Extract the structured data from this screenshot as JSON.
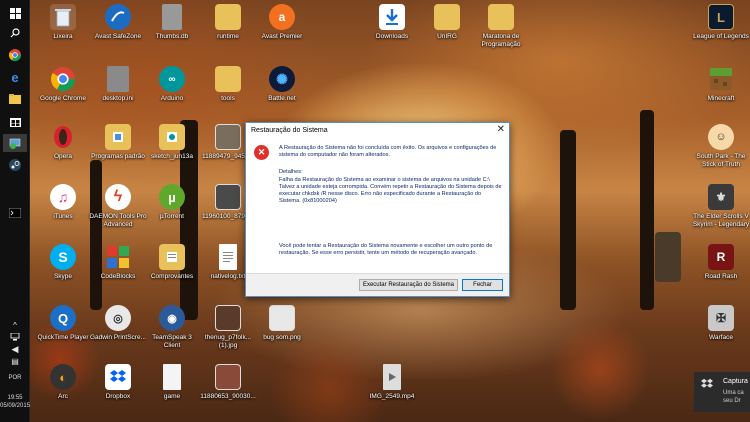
{
  "desktop_icons": [
    {
      "name": "lixeira",
      "label": "Lixeira",
      "icon": "recycle-bin-icon"
    },
    {
      "name": "avast-safezone",
      "label": "Avast SafeZone",
      "icon": "avast-safezone-icon"
    },
    {
      "name": "thumbs-db",
      "label": "Thumbs.db",
      "icon": "file-icon"
    },
    {
      "name": "runtime",
      "label": "runtime",
      "icon": "file-icon"
    },
    {
      "name": "avast-premier",
      "label": "Avast Premier",
      "icon": "avast-icon"
    },
    {
      "name": "downloads",
      "label": "Downloads",
      "icon": "downloads-icon"
    },
    {
      "name": "unirg",
      "label": "UnIRG",
      "icon": "folder-icon"
    },
    {
      "name": "maratona",
      "label": "Maratona de Programação",
      "icon": "folder-icon"
    },
    {
      "name": "league-of-legends",
      "label": "League of Legends",
      "icon": "league-of-legends-icon"
    },
    {
      "name": "google-chrome",
      "label": "Google Chrome",
      "icon": "chrome-icon"
    },
    {
      "name": "desktop-ini",
      "label": "desktop.ini",
      "icon": "file-icon"
    },
    {
      "name": "arduino",
      "label": "Arduino",
      "icon": "arduino-icon"
    },
    {
      "name": "tools",
      "label": "tools",
      "icon": "folder-icon"
    },
    {
      "name": "battlenet",
      "label": "Battle.net",
      "icon": "battlenet-icon"
    },
    {
      "name": "minecraft",
      "label": "Minecraft",
      "icon": "minecraft-icon"
    },
    {
      "name": "opera",
      "label": "Opera",
      "icon": "opera-icon"
    },
    {
      "name": "programas-padrao",
      "label": "Programas padrão",
      "icon": "folder-icon"
    },
    {
      "name": "sketch",
      "label": "sketch_jun13a",
      "icon": "folder-icon"
    },
    {
      "name": "file-11889479",
      "label": "11889479_9455...",
      "icon": "photo-icon"
    },
    {
      "name": "south-park",
      "label": "South Park - The Stick of Truth",
      "icon": "south-park-icon"
    },
    {
      "name": "itunes",
      "label": "iTunes",
      "icon": "itunes-icon"
    },
    {
      "name": "daemon-tools",
      "label": "DAEMON Tools Pro Advanced",
      "icon": "daemon-tools-icon"
    },
    {
      "name": "utorrent",
      "label": "µTorrent",
      "icon": "utorrent-icon"
    },
    {
      "name": "file-11960100",
      "label": "11960100_8792...",
      "icon": "photo-icon"
    },
    {
      "name": "elder-scrolls",
      "label": "The Elder Scrolls V Skyrim - Legendary",
      "icon": "skyrim-icon"
    },
    {
      "name": "skype",
      "label": "Skype",
      "icon": "skype-icon"
    },
    {
      "name": "codeblocks",
      "label": "CodeBlocks",
      "icon": "codeblocks-icon"
    },
    {
      "name": "comprovantes",
      "label": "Comprovantes",
      "icon": "folder-icon"
    },
    {
      "name": "nativelog",
      "label": "nativelog.txt",
      "icon": "text-file-icon"
    },
    {
      "name": "road-rash",
      "label": "Road Rash",
      "icon": "road-rash-icon"
    },
    {
      "name": "quicktime",
      "label": "QuickTime Player",
      "icon": "quicktime-icon"
    },
    {
      "name": "gadwin",
      "label": "Gadwin PrintScre...",
      "icon": "gadwin-icon"
    },
    {
      "name": "teamspeak",
      "label": "TeamSpeak 3 Client",
      "icon": "teamspeak-icon"
    },
    {
      "name": "thenug",
      "label": "thenug_p7folk... (1).jpg",
      "icon": "photo-icon"
    },
    {
      "name": "bug-som",
      "label": "bug som.png",
      "icon": "photo-icon"
    },
    {
      "name": "warface",
      "label": "Warface",
      "icon": "warface-icon"
    },
    {
      "name": "arc",
      "label": "Arc",
      "icon": "arc-icon"
    },
    {
      "name": "dropbox",
      "label": "Dropbox",
      "icon": "dropbox-icon"
    },
    {
      "name": "game",
      "label": "game",
      "icon": "file-icon"
    },
    {
      "name": "file-11880653",
      "label": "11880653_90030...",
      "icon": "photo-icon"
    },
    {
      "name": "img-2549",
      "label": "IMG_2549.mp4",
      "icon": "video-file-icon"
    }
  ],
  "taskbar": {
    "language": "POR",
    "time": "19:55",
    "date": "05/09/2015",
    "icons": [
      "windows-start-icon",
      "search-icon",
      "chrome-icon",
      "edge-icon",
      "file-explorer-icon",
      "store-icon",
      "system-restore-icon",
      "steam-icon",
      "cmd-icon"
    ]
  },
  "dialog": {
    "title": "Restauração do Sistema",
    "message": "A Restauração do Sistema não foi concluída com êxito. Os arquivos e configurações de sistema do computador não foram alterados.",
    "details_heading": "Detalhes:",
    "details": "Falha da Restauração do Sistema ao examinar o sistema de arquivos na unidade C:\\ Talvez a unidade esteja corrompida. Convém repetir a Restauração do Sistema depois de executar chkdsk /R nesse disco. Erro não especificado durante a Restauração do Sistema. (0x81000204)",
    "hint": "Você pode tentar a Restauração do Sistema novamente e escolher um outro ponto de restauração. Se esse erro persistir, tente um método de recuperação avançado.",
    "run_button": "Executar Restauração do Sistema",
    "close_button": "Fechar"
  },
  "notification": {
    "title": "Captura",
    "body_line1": "Uma ca",
    "body_line2": "seu Dr"
  }
}
